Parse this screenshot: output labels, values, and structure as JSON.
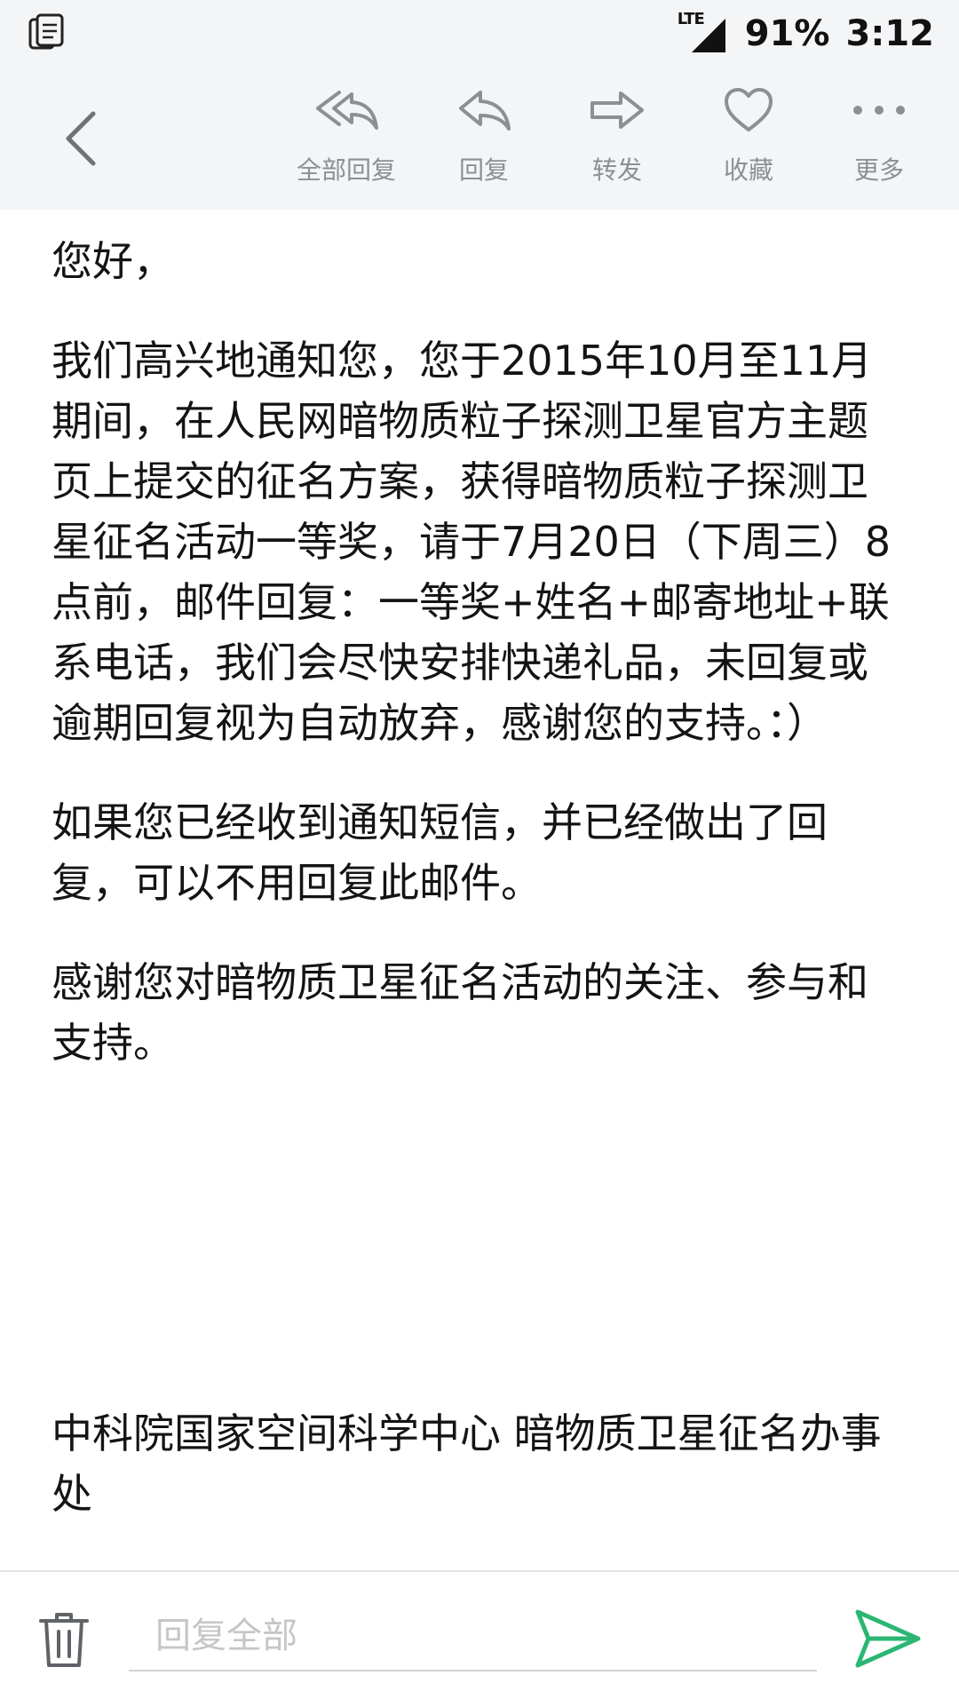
{
  "status_bar": {
    "network": "LTE",
    "battery": "91%",
    "time": "3:12"
  },
  "toolbar": {
    "actions": [
      {
        "label": "全部回复",
        "icon": "reply-all-icon"
      },
      {
        "label": "回复",
        "icon": "reply-icon"
      },
      {
        "label": "转发",
        "icon": "forward-icon"
      },
      {
        "label": "收藏",
        "icon": "heart-icon"
      },
      {
        "label": "更多",
        "icon": "more-icon"
      }
    ]
  },
  "email": {
    "greeting": "您好，",
    "paragraphs": [
      "我们高兴地通知您，您于2015年10月至11月期间，在人民网暗物质粒子探测卫星官方主题页上提交的征名方案，获得暗物质粒子探测卫星征名活动一等奖，请于7月20日（下周三）8点前，邮件回复：一等奖+姓名+邮寄地址+联系电话，我们会尽快安排快递礼品，未回复或逾期回复视为自动放弃，感谢您的支持。：）",
      "如果您已经收到通知短信，并已经做出了回复，可以不用回复此邮件。",
      "感谢您对暗物质卫星征名活动的关注、参与和支持。"
    ],
    "signature": "中科院国家空间科学中心 暗物质卫星征名办事处"
  },
  "bottom_bar": {
    "reply_placeholder": "回复全部"
  },
  "colors": {
    "header_bg": "#f4f5f7",
    "icon_gray": "#8c8f94",
    "send_green": "#2bb673"
  }
}
